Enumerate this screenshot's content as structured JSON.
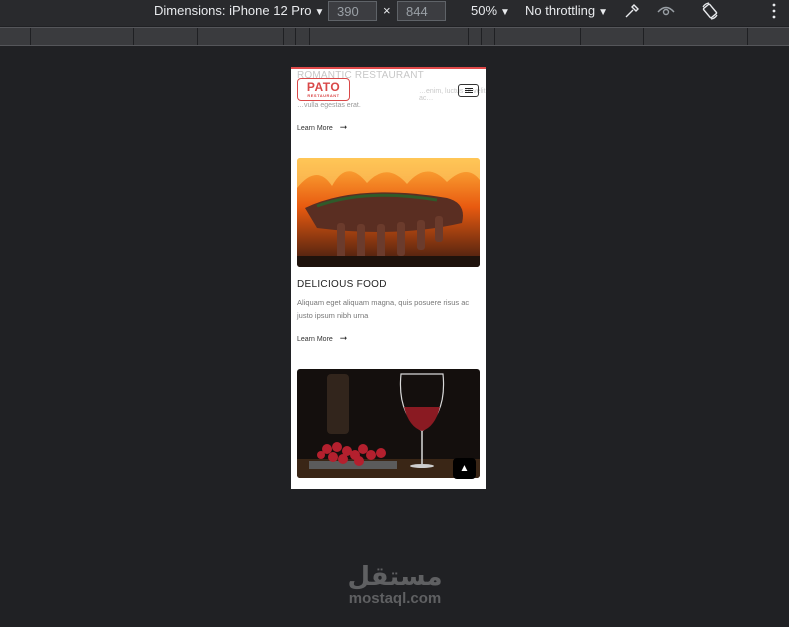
{
  "devtools": {
    "dimensions_label": "Dimensions: iPhone 12 Pro",
    "width_value": "390",
    "times": "×",
    "height_value": "844",
    "zoom": "50%",
    "throttling": "No throttling",
    "icons": [
      "eyedropper-icon",
      "vision-icon",
      "rotate-icon",
      "more-vert-icon"
    ]
  },
  "site": {
    "logo_main": "PATO",
    "logo_sub": "RESTAURANT",
    "ghost_title": "ROMANTIC RESTAURANT",
    "ghost_line1": "…enim, luctus ut velit ac…",
    "ghost_line2": "…vulla egestas erat.",
    "learn_more": "Learn More",
    "arrow": "➞",
    "card2_title": "DELICIOUS FOOD",
    "card2_desc": "Aliquam eget aliquam magna, quis posuere risus ac justo ipsum nibh urna",
    "accent_color": "#d94848"
  },
  "watermark": {
    "arabic": "مستقل",
    "latin": "mostaql.com"
  }
}
